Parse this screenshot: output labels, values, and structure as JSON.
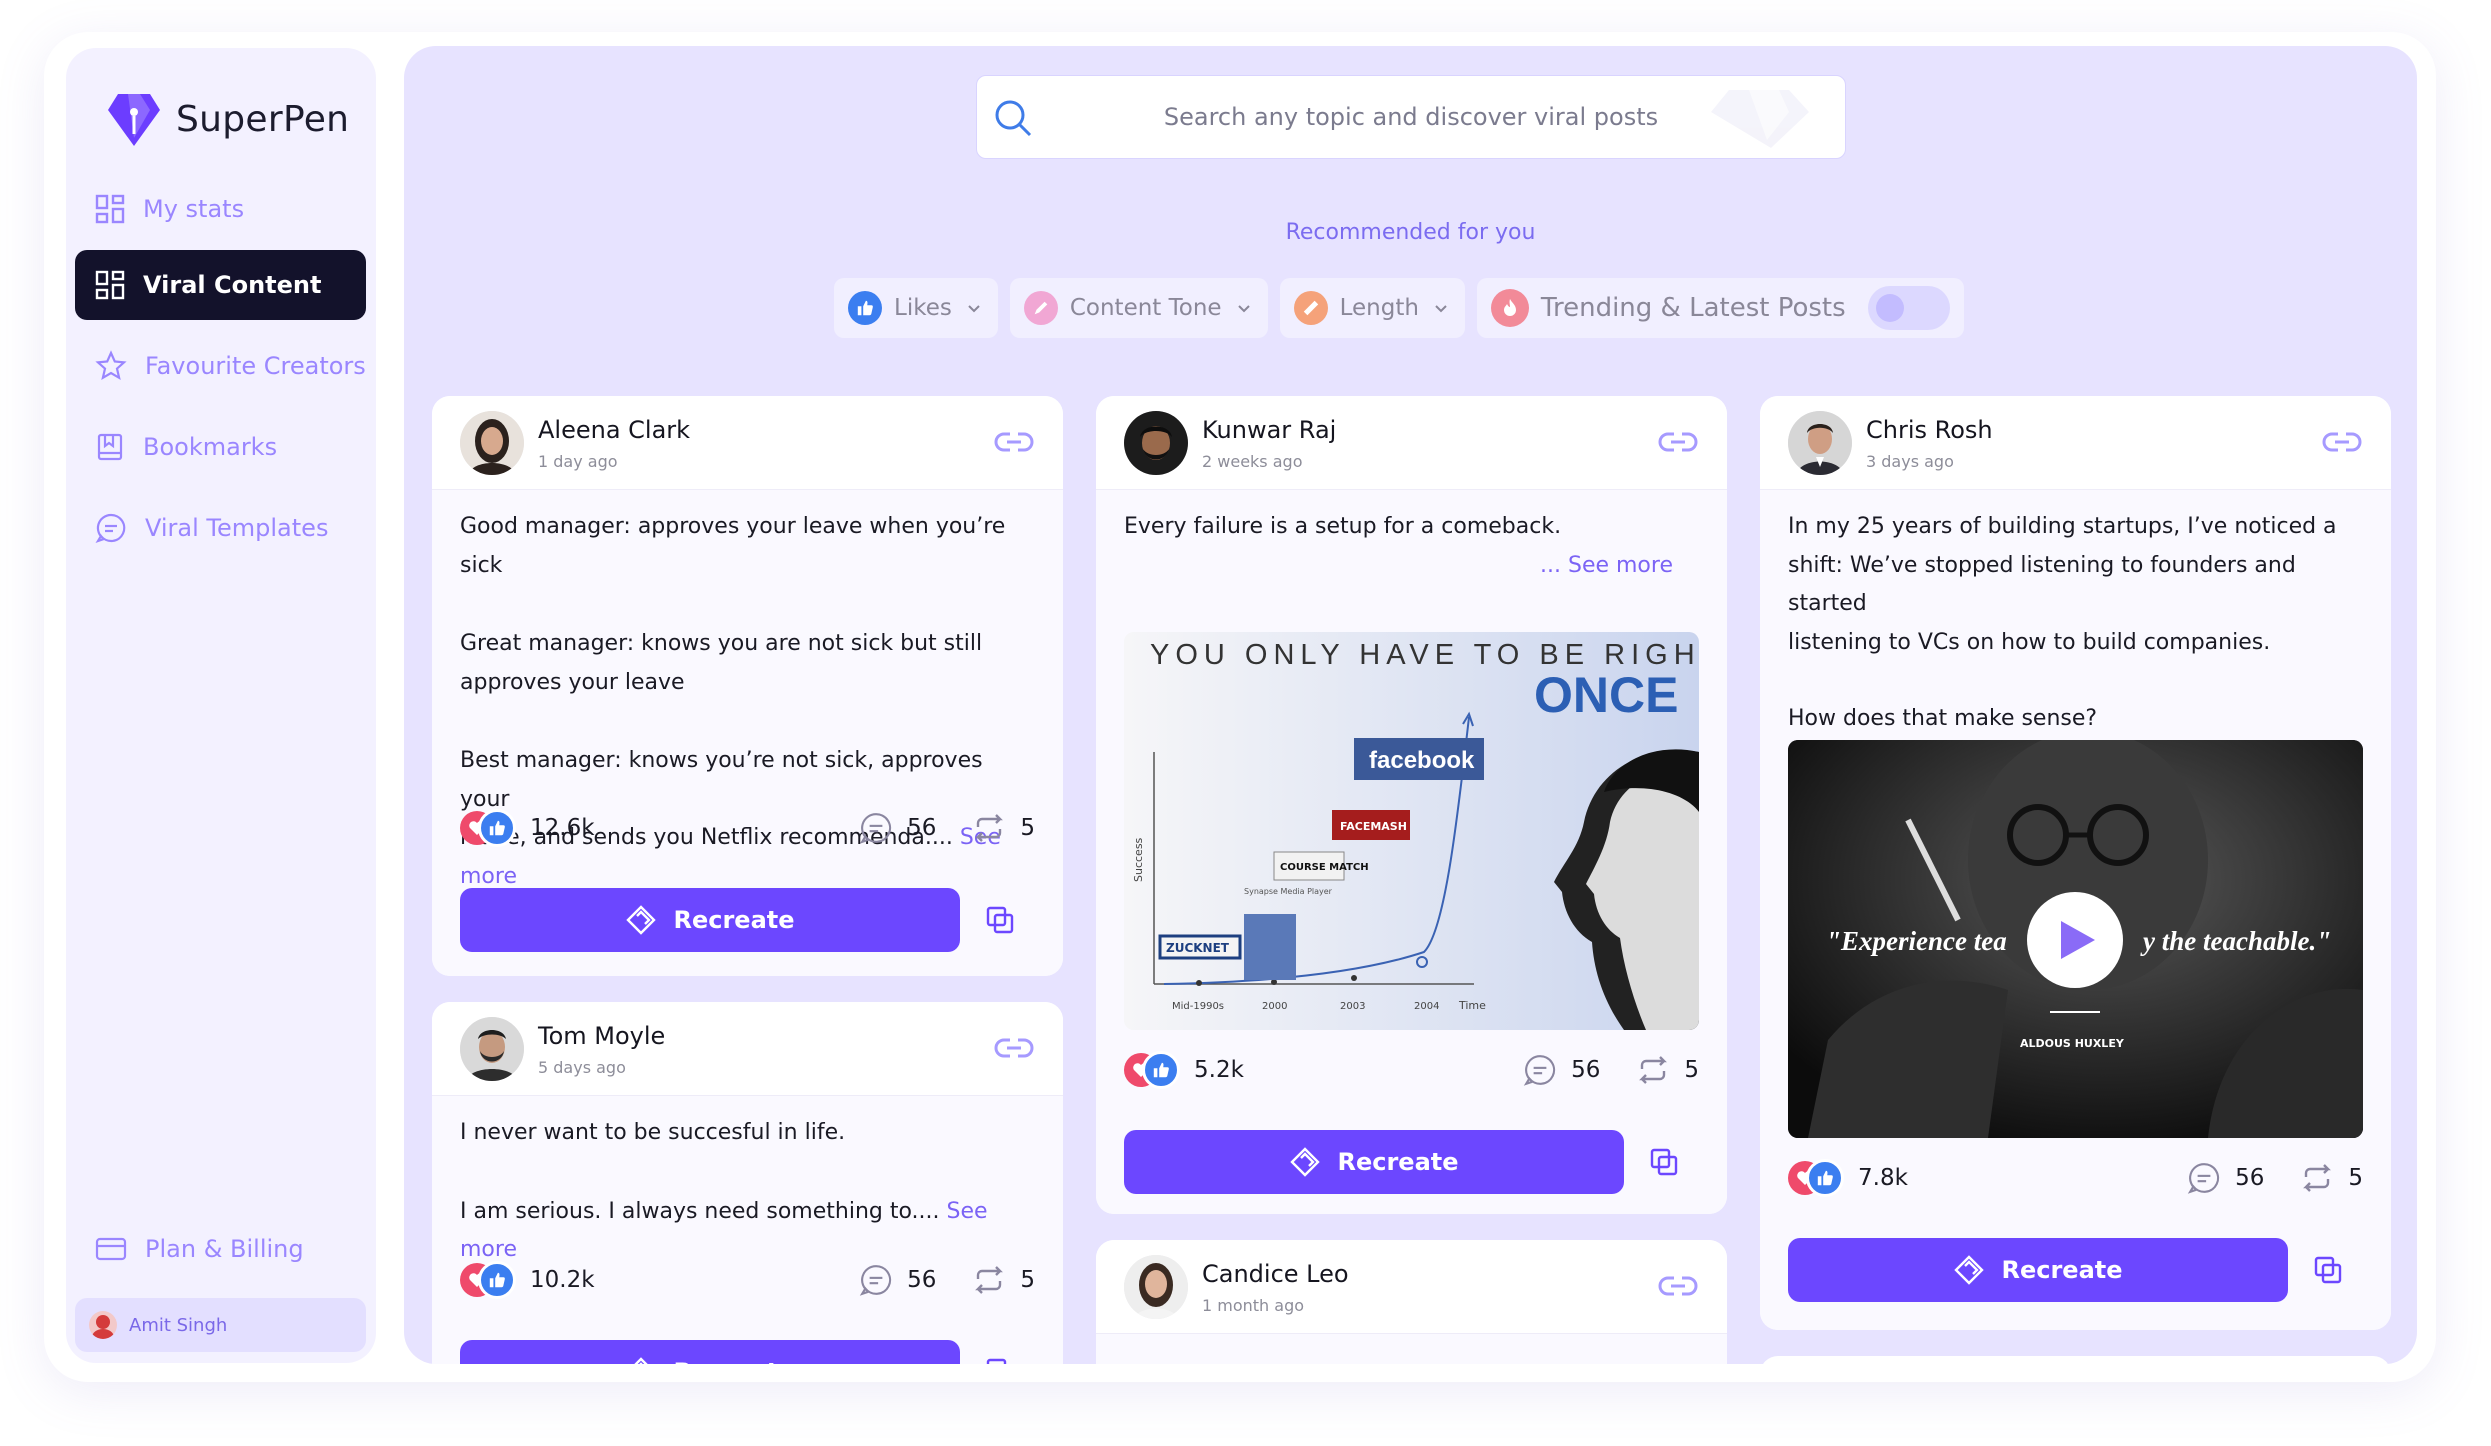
{
  "app": {
    "name": "SuperPen"
  },
  "sidebar": {
    "items": [
      {
        "label": "My stats",
        "icon": "grid-icon"
      },
      {
        "label": "Viral Content",
        "icon": "grid-icon",
        "active": true
      },
      {
        "label": "Favourite Creators",
        "icon": "star-icon"
      },
      {
        "label": "Bookmarks",
        "icon": "bookmark-icon"
      },
      {
        "label": "Viral Templates",
        "icon": "chat-icon"
      }
    ],
    "plan_billing": "Plan & Billing",
    "user_name": "Amit Singh"
  },
  "search": {
    "placeholder": "Search any topic and discover viral posts"
  },
  "recommended": "Recommended for you",
  "filters": {
    "likes": "Likes",
    "tone": "Content Tone",
    "length": "Length",
    "trending": "Trending & Latest Posts",
    "trending_on": false
  },
  "colors": {
    "accent": "#6c47ff",
    "nav_active": "#13122b",
    "main_bg": "#e7e3ff",
    "like": "#3b7ef0",
    "heart": "#ef4a6b"
  },
  "recreate_label": "Recreate",
  "see_more": "See more",
  "posts": [
    {
      "name": "Aleena Clark",
      "time": "1 day ago",
      "p1": "Good manager: approves your leave when you’re sick",
      "p2a": "Great manager: knows you are not sick but still",
      "p2b": "approves your leave",
      "p3a": "Best manager: knows you’re not sick, approves your",
      "p3b": "leave, and sends you Netflix recommenda.... ",
      "likes": "12.6k",
      "comments": "56",
      "reposts": "5"
    },
    {
      "name": "Tom Moyle",
      "time": "5 days ago",
      "p1": "I never want to be succesful in life.",
      "p2": "I am serious. I always need something to.... ",
      "likes": "10.2k",
      "comments": "56",
      "reposts": "5"
    },
    {
      "name": "Kunwar Raj",
      "time": "2 weeks ago",
      "p1": "Every failure is a setup for a comeback.",
      "more": "... See more",
      "image": {
        "headline": "YOU ONLY HAVE TO BE RIGHT",
        "headline2": "ONCE",
        "labels": {
          "facebook": "facebook",
          "facemash": "FACEMASH",
          "coursematch": "COURSE MATCH",
          "synapse": "Synapse Media Player",
          "zucknet": "ZUCKNET",
          "success": "Success",
          "time": "Time"
        },
        "ticks": [
          "Mid-1990s",
          "2000",
          "2003",
          "2004"
        ]
      },
      "likes": "5.2k",
      "comments": "56",
      "reposts": "5"
    },
    {
      "name": "Candice Leo",
      "time": "1 month ago"
    },
    {
      "name": "Chris Rosh",
      "time": "3 days ago",
      "p1": "In my 25 years of building startups, I’ve noticed a",
      "p2": "shift: We’ve stopped listening to founders and started",
      "p3": "listening to VCs on how to build companies.",
      "p4": "How does that make sense?",
      "video": {
        "quote_left": "\"Experience tea",
        "quote_right": "y the teachable.\"",
        "author": "ALDOUS HUXLEY"
      },
      "likes": "7.8k",
      "comments": "56",
      "reposts": "5"
    }
  ]
}
